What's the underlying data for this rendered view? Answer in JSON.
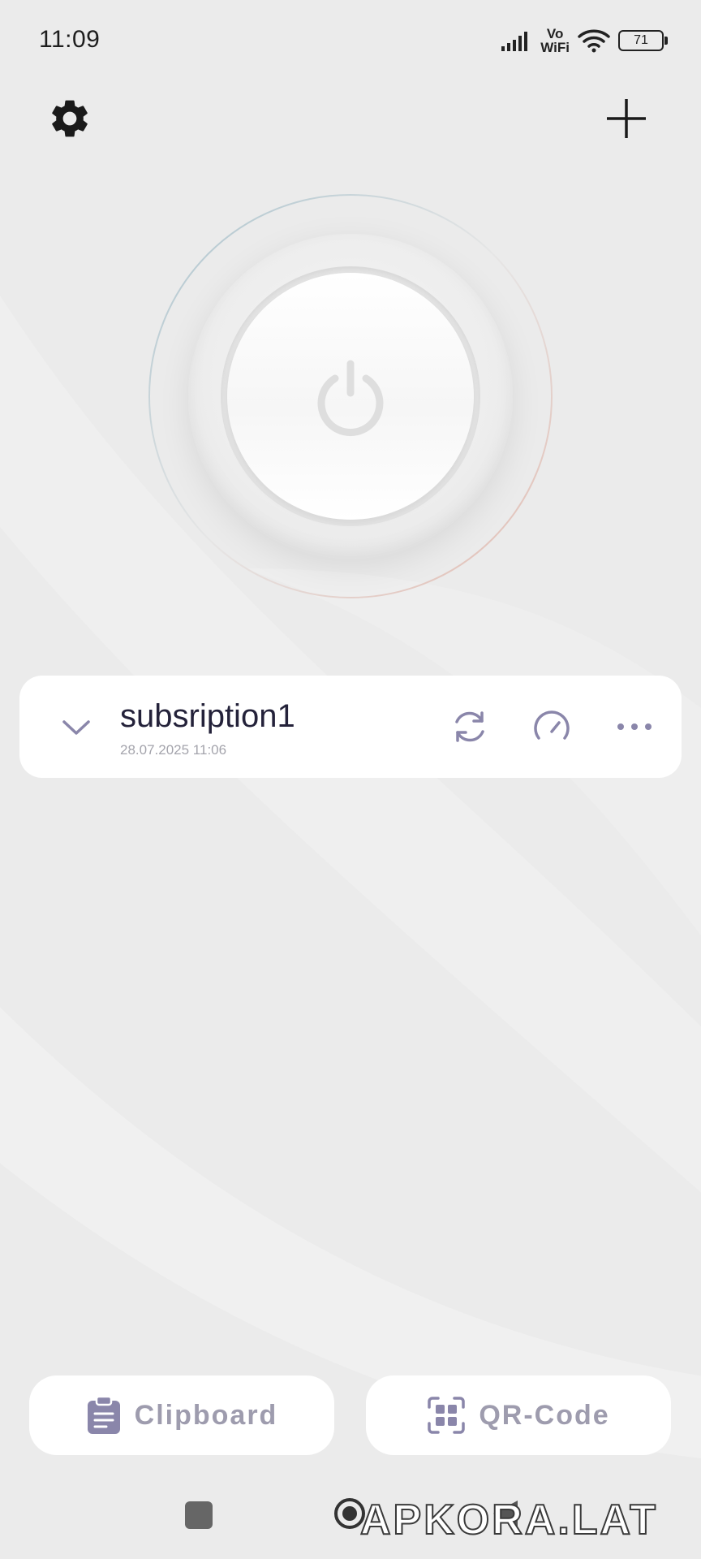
{
  "status_bar": {
    "time": "11:09",
    "vo": "Vo",
    "wifi": "WiFi",
    "battery": "71",
    "icons": [
      "signal-icon",
      "vowifi-icon",
      "wifi-icon",
      "battery-icon"
    ]
  },
  "top_bar": {
    "icons": [
      "gear-icon",
      "plus-icon"
    ]
  },
  "power": {
    "icon": "power-icon"
  },
  "subscription": {
    "title": "subsription1",
    "date": "28.07.2025 11:06",
    "icons": [
      "chevron-down-icon",
      "refresh-icon",
      "speedometer-icon",
      "more-icon"
    ]
  },
  "bottom": {
    "clipboard_label": "Clipboard",
    "qr_label": "QR-Code",
    "icons": [
      "clipboard-icon",
      "qr-scan-icon"
    ]
  },
  "watermark": "APKORA.LAT",
  "colors": {
    "background": "#ebebeb",
    "card": "#ffffff",
    "accent": "#8a86aa",
    "title": "#24223a"
  }
}
